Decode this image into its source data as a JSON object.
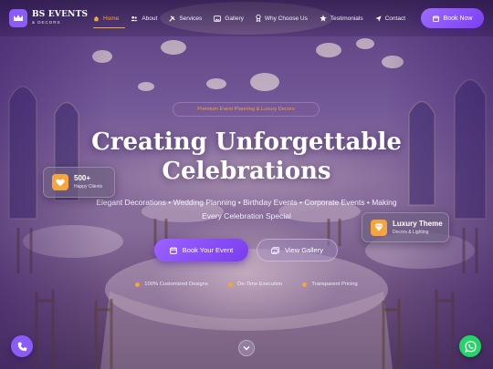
{
  "brand": {
    "name": "BS EVENTS",
    "tagline": "& DECORS",
    "logo_icon": "crown-icon"
  },
  "nav": {
    "items": [
      {
        "label": "Home",
        "icon": "home-icon",
        "active": true
      },
      {
        "label": "About",
        "icon": "user-group-icon",
        "active": false
      },
      {
        "label": "Services",
        "icon": "tools-icon",
        "active": false
      },
      {
        "label": "Gallery",
        "icon": "image-icon",
        "active": false
      },
      {
        "label": "Why Choose Us",
        "icon": "award-icon",
        "active": false
      },
      {
        "label": "Testimonials",
        "icon": "star-icon",
        "active": false
      },
      {
        "label": "Contact",
        "icon": "send-icon",
        "active": false
      }
    ],
    "cta_label": "Book Now",
    "cta_icon": "calendar-icon"
  },
  "hero": {
    "tag": "Premium Event Planning & Luxury Decors",
    "title_line1": "Creating Unforgettable",
    "title_line2": "Celebrations",
    "subtitle_line1": "Elegant Decorations • Wedding Planning • Birthday Events • Corporate Events • Making",
    "subtitle_line2": "Every Celebration Special",
    "primary_button": "Book Your Event",
    "secondary_button": "View Gallery",
    "features": [
      "100% Customized Designs",
      "On-Time Execution",
      "Transparent Pricing"
    ]
  },
  "stats": {
    "clients_value": "500+",
    "clients_label": "Happy Clients",
    "luxury_title": "Luxury Theme",
    "luxury_sub": "Decors & Lighting"
  },
  "colors": {
    "accent_purple": "#8b5cf6",
    "accent_orange": "#f6a43c",
    "whatsapp_green": "#25d366"
  }
}
